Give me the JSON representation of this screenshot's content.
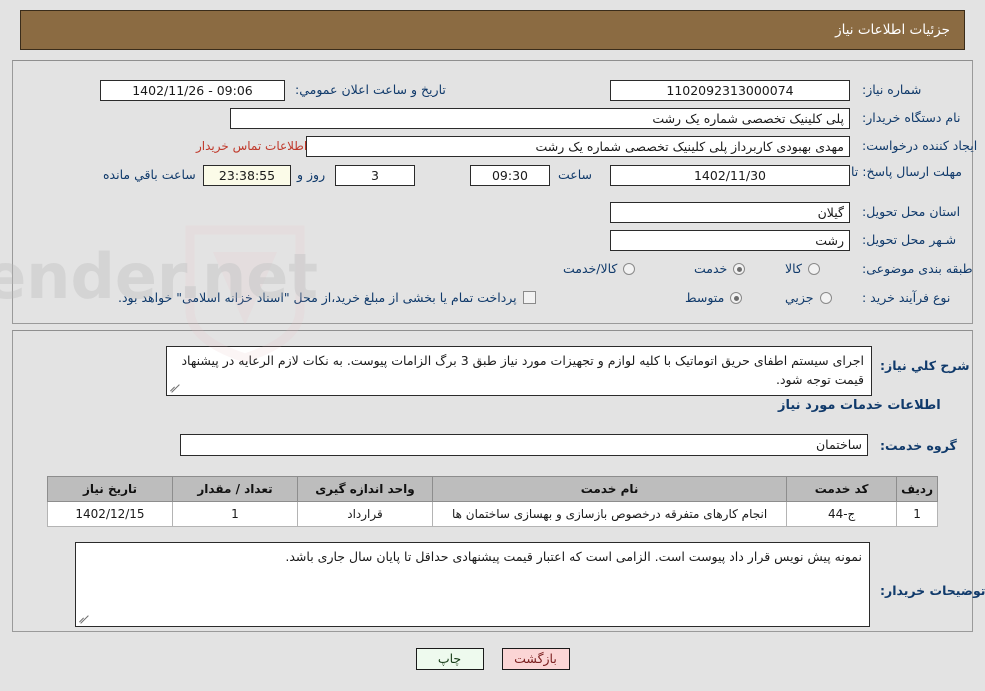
{
  "header": {
    "title": "جزئیات اطلاعات نیاز"
  },
  "form": {
    "need_number": {
      "label": "شماره نیاز:",
      "value": "1102092313000074"
    },
    "announce_datetime": {
      "label": "تاریخ و ساعت اعلان عمومي:",
      "value": "09:06 - 1402/11/26"
    },
    "buyer_org": {
      "label": "نام دستگاه خریدار:",
      "value": "پلی کلینیک تخصصی شماره یک رشت"
    },
    "creator": {
      "label": "ایجاد کننده درخواست:",
      "value": "مهدی بهبودی کاربرداز پلی کلینیک تخصصی شماره یک رشت"
    },
    "contact_link": "اطلاعات تماس خریدار",
    "deadline": {
      "label": "مهلت ارسال پاسخ: تا تاریخ:",
      "date": "1402/11/30",
      "time_label": "ساعت",
      "time": "09:30",
      "days": "3",
      "days_suffix": "روز و",
      "countdown": "23:38:55",
      "countdown_suffix": "ساعت باقي مانده"
    },
    "province": {
      "label": "استان محل تحویل:",
      "value": "گیلان"
    },
    "city": {
      "label": "شـهر محل تحویل:",
      "value": "رشت"
    },
    "category": {
      "label": "طبقه بندی موضوعی:",
      "options": [
        {
          "label": "کالا",
          "selected": false
        },
        {
          "label": "خدمت",
          "selected": true
        },
        {
          "label": "کالا/خدمت",
          "selected": false
        }
      ]
    },
    "purchase_process": {
      "label": "نوع فرآیند خرید :",
      "options": [
        {
          "label": "جزیي",
          "selected": false
        },
        {
          "label": "متوسط",
          "selected": true
        }
      ],
      "checkbox_label": "پرداخت تمام یا بخشی از مبلغ خرید،از محل \"اسناد خزانه اسلامی\" خواهد بود.",
      "checkbox_checked": false
    }
  },
  "need_summary": {
    "label": "شرح کلي نیاز:",
    "value": "اجرای سیستم اطفای حریق اتوماتیک با کلیه لوازم و تجهیزات مورد نیاز طبق 3 برگ الزامات پیوست. به نکات لازم الرعایه در پیشنهاد قیمت توجه شود."
  },
  "services_section": {
    "heading": "اطلاعات خدمات مورد نیاز",
    "group_label": "گروه خدمت:",
    "group_value": "ساختمان",
    "table": {
      "columns": [
        "ردیف",
        "کد خدمت",
        "نام خدمت",
        "واحد اندازه گیری",
        "تعداد / مقدار",
        "تاریخ نیاز"
      ],
      "rows": [
        {
          "row": "1",
          "code": "ج-44",
          "name": "انجام کارهای متفرقه درخصوص بازسازی و بهسازی ساختمان ها",
          "unit": "قرارداد",
          "qty": "1",
          "date": "1402/12/15"
        }
      ]
    }
  },
  "buyer_notes": {
    "label": "توضیحات خریدار:",
    "value": "نمونه پیش نویس قرار داد پیوست است. الزامی است که اعتبار قیمت پیشنهادی حداقل تا پایان سال جاری باشد."
  },
  "buttons": {
    "print": "چاپ",
    "back": "بازگشت"
  },
  "watermark": {
    "text": "AnaTender.net"
  }
}
